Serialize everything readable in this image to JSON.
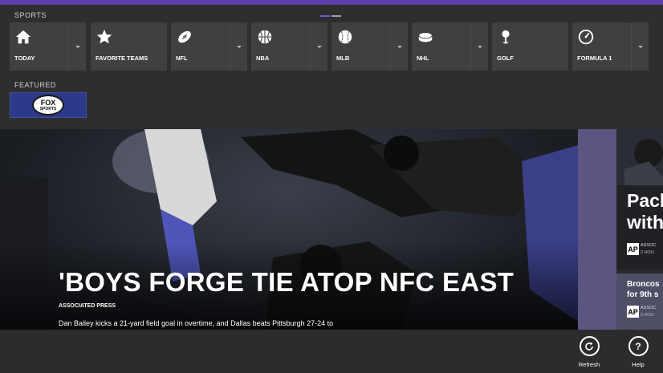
{
  "header": {
    "section_title": "SPORTS",
    "featured_title": "FEATURED"
  },
  "nav_tiles": [
    {
      "label": "TODAY",
      "icon": "home-icon"
    },
    {
      "label": "FAVORITE TEAMS",
      "icon": "star-icon"
    },
    {
      "label": "NFL",
      "icon": "football-icon"
    },
    {
      "label": "NBA",
      "icon": "basketball-icon"
    },
    {
      "label": "MLB",
      "icon": "baseball-icon"
    },
    {
      "label": "NHL",
      "icon": "hockey-puck-icon"
    },
    {
      "label": "GOLF",
      "icon": "golf-icon"
    },
    {
      "label": "FORMULA 1",
      "icon": "speedometer-icon"
    }
  ],
  "featured": {
    "logo_text": "FOX",
    "logo_subtext": "SPORTS"
  },
  "hero": {
    "title": "'BOYS FORGE TIE ATOP NFC EAST",
    "source": "ASSOCIATED PRESS",
    "summary": "Dan Bailey kicks a 21-yard field goal in overtime, and Dallas beats Pittsburgh 27-24 to"
  },
  "side_cards": [
    {
      "headline_line1": "Pack",
      "headline_line2": "with",
      "badge": "AP",
      "source": "ASSOC",
      "time": "2 HOU"
    },
    {
      "headline_line1": "Broncos",
      "headline_line2": "for 9th s",
      "badge": "AP",
      "source": "ASSOC",
      "time": "2 HOU"
    }
  ],
  "app_bar": {
    "refresh_label": "Refresh",
    "help_label": "Help",
    "help_glyph": "?"
  },
  "colors": {
    "accent_purple": "#5b3ea6",
    "tile_bg": "#404040",
    "fox_blue": "#2d3a8a",
    "strip_purple": "#5b5581"
  }
}
